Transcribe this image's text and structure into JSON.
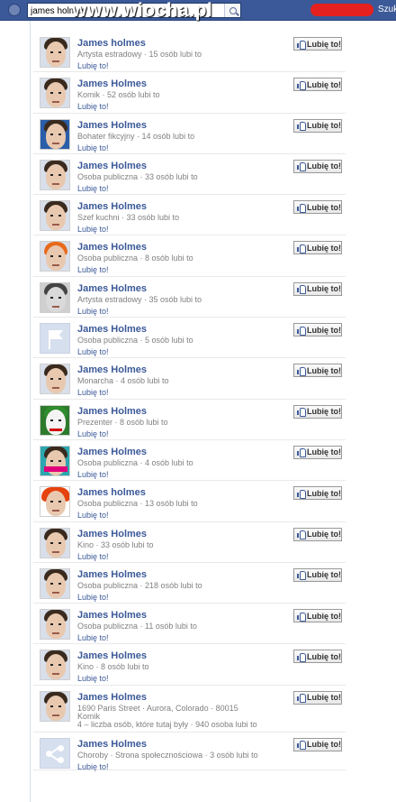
{
  "header": {
    "search_value": "james holmes",
    "watermark": "www.wiocha.pl",
    "search_right_label": "Szuka"
  },
  "results": [
    {
      "name": "James holmes",
      "meta": "Artysta estradowy · 15 osób lubi to",
      "like_link": "Lubię to!",
      "like_button": "Lubię to!"
    },
    {
      "name": "James Holmes",
      "meta": "Komik · 52 osób lubi to",
      "like_link": "Lubię to!",
      "like_button": "Lubię to!"
    },
    {
      "name": "James Holmes",
      "meta": "Bohater fikcyjny · 14 osób lubi to",
      "like_link": "Lubię to!",
      "like_button": "Lubię to!"
    },
    {
      "name": "James Holmes",
      "meta": "Osoba publiczna · 33 osób lubi to",
      "like_link": "Lubię to!",
      "like_button": "Lubię to!"
    },
    {
      "name": "James Holmes",
      "meta": "Szef kuchni · 33 osób lubi to",
      "like_link": "Lubię to!",
      "like_button": "Lubię to!"
    },
    {
      "name": "James Holmes",
      "meta": "Osoba publiczna · 8 osób lubi to",
      "like_link": "Lubię to!",
      "like_button": "Lubię to!"
    },
    {
      "name": "James Holmes",
      "meta": "Artysta estradowy · 35 osób lubi to",
      "like_link": "Lubię to!",
      "like_button": "Lubię to!"
    },
    {
      "name": "James Holmes",
      "meta": "Osoba publiczna · 5 osób lubi to",
      "like_link": "Lubię to!",
      "like_button": "Lubię to!"
    },
    {
      "name": "James Holmes",
      "meta": "Monarcha · 4 osób lubi to",
      "like_link": "Lubię to!",
      "like_button": "Lubię to!"
    },
    {
      "name": "James Holmes",
      "meta": "Prezenter · 8 osób lubi to",
      "like_link": "Lubię to!",
      "like_button": "Lubię to!"
    },
    {
      "name": "James Holmes",
      "meta": "Osoba publiczna · 4 osób lubi to",
      "like_link": "Lubię to!",
      "like_button": "Lubię to!"
    },
    {
      "name": "James holmes",
      "meta": "Osoba publiczna · 13 osób lubi to",
      "like_link": "Lubię to!",
      "like_button": "Lubię to!"
    },
    {
      "name": "James Holmes",
      "meta": "Kino · 33 osób lubi to",
      "like_link": "Lubię to!",
      "like_button": "Lubię to!"
    },
    {
      "name": "James Holmes",
      "meta": "Osoba publiczna · 218 osób lubi to",
      "like_link": "Lubię to!",
      "like_button": "Lubię to!"
    },
    {
      "name": "James Holmes",
      "meta": "Osoba publiczna · 11 osób lubi to",
      "like_link": "Lubię to!",
      "like_button": "Lubię to!"
    },
    {
      "name": "James Holmes",
      "meta": "Kino · 8 osób lubi to",
      "like_link": "Lubię to!",
      "like_button": "Lubię to!"
    },
    {
      "name": "James Holmes",
      "meta": "1690 Paris Street · Aurora, Colorado · 80015",
      "meta2": "Komik",
      "meta3": "4 – liczba osób, które tutaj były · 940 osoba lubi to",
      "like_link": "Lubię to!",
      "like_button": "Lubię to!"
    },
    {
      "name": "James Holmes",
      "meta": "Choroby · Strona społecznościowa · 3 osób lubi to",
      "like_link": "Lubię to!",
      "like_button": "Lubię to!"
    }
  ]
}
